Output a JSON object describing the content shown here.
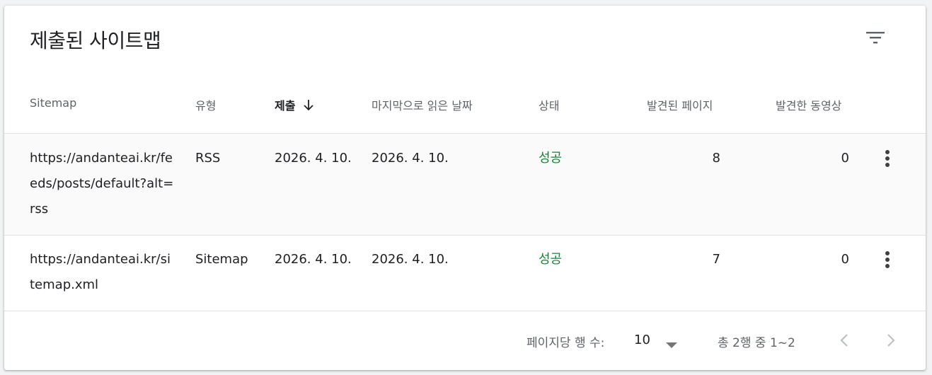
{
  "panel": {
    "title": "제출된 사이트맵",
    "filter_icon": "filter-icon"
  },
  "table": {
    "headers": {
      "sitemap": "Sitemap",
      "type": "유형",
      "submitted": "제출",
      "last_read": "마지막으로 읽은 날짜",
      "status": "상태",
      "pages": "발견된 페이지",
      "videos": "발견한 동영상"
    },
    "sort": {
      "column": "submitted",
      "direction": "descending"
    },
    "rows": [
      {
        "sitemap": "https://andanteai.kr/feeds/posts/default?alt=rss",
        "type": "RSS",
        "submitted": "2026. 4. 10.",
        "last_read": "2026. 4. 10.",
        "status": "성공",
        "pages": "8",
        "videos": "0"
      },
      {
        "sitemap": "https://andanteai.kr/sitemap.xml",
        "type": "Sitemap",
        "submitted": "2026. 4. 10.",
        "last_read": "2026. 4. 10.",
        "status": "성공",
        "pages": "7",
        "videos": "0"
      }
    ]
  },
  "footer": {
    "rows_per_page_label": "페이지당 행 수:",
    "rows_per_page_value": "10",
    "range_text": "총 2행 중 1~2"
  },
  "colors": {
    "success": "#188038",
    "header_text": "#5f6368",
    "body_text": "#202124",
    "divider": "#e0e0e0"
  }
}
